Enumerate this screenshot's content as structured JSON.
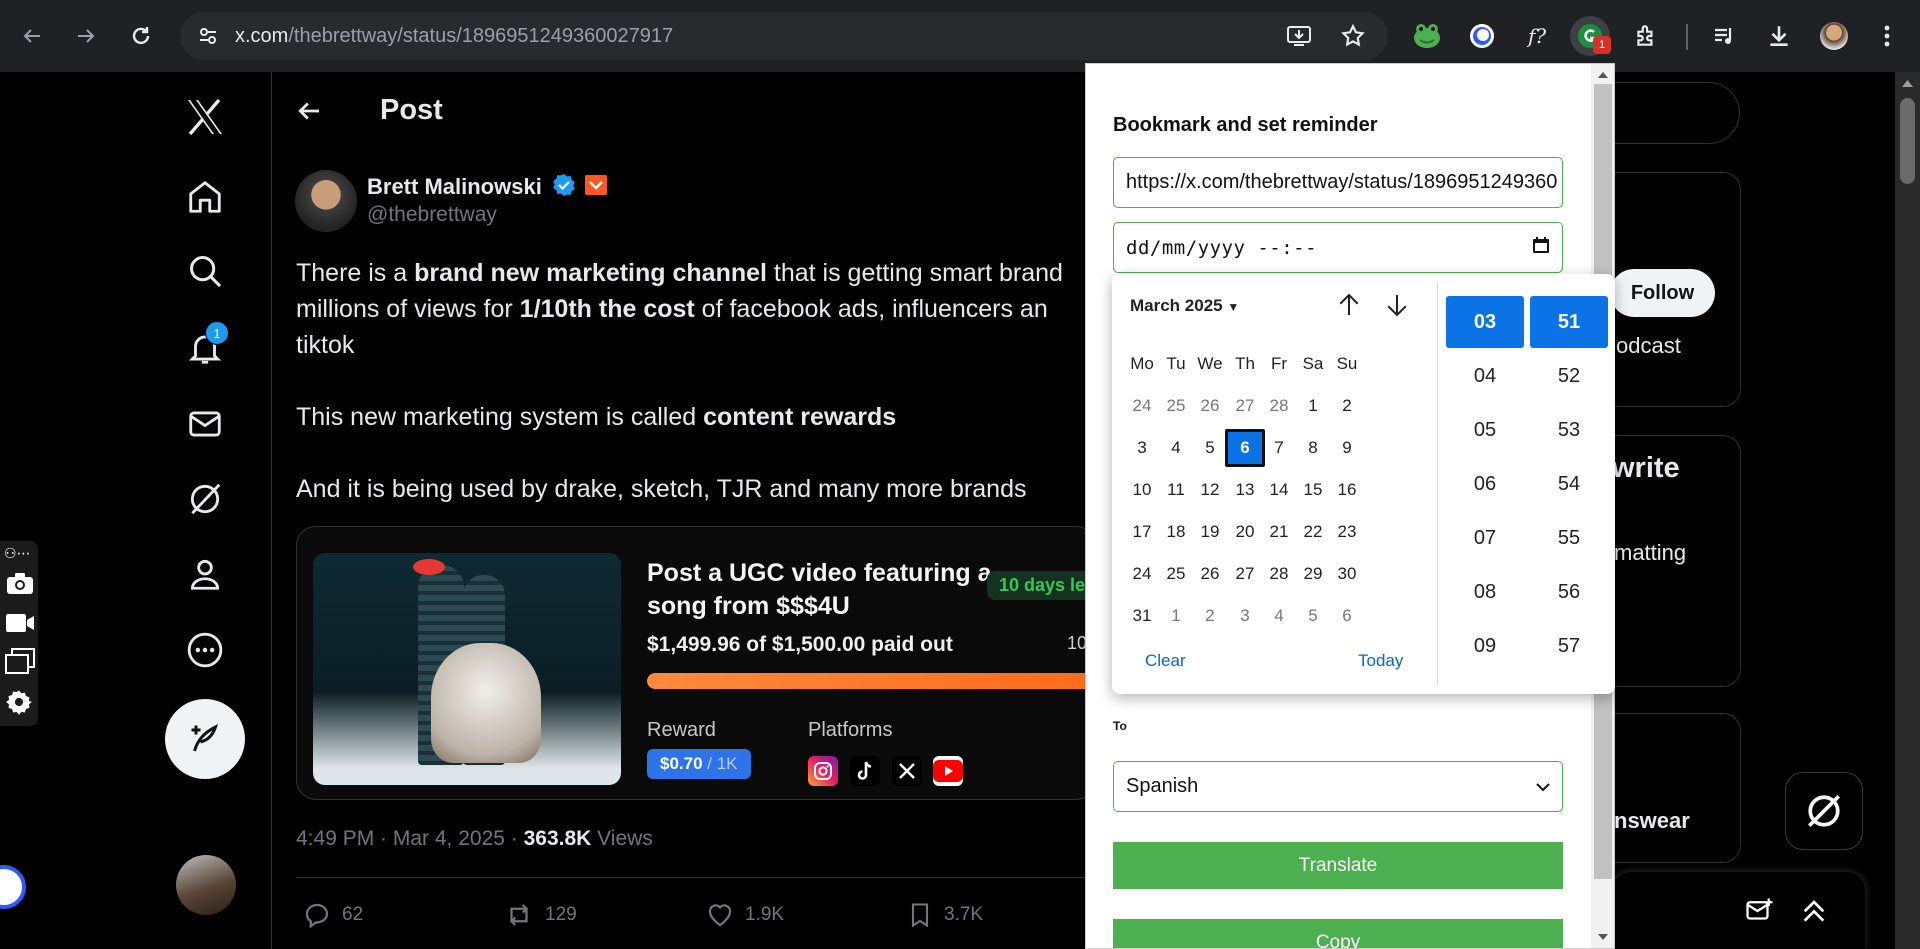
{
  "browser": {
    "url_host": "x.com",
    "url_path": "/thebrettway/status/1896951249360027917",
    "extension_badge": "1"
  },
  "nav": {
    "notifications_badge": "1"
  },
  "post": {
    "header_title": "Post",
    "author_name": "Brett Malinowski",
    "author_handle": "@thebrettway",
    "line1_a": "There is a ",
    "line1_b": "brand new marketing channel",
    "line1_c": " that is getting smart brand",
    "line2_a": "millions of views for ",
    "line2_b": "1/10th the cost",
    "line2_c": " of facebook ads, influencers an",
    "line3": "tiktok",
    "line4_a": "This new marketing system is called ",
    "line4_b": "content rewards",
    "line5": "And it is being used by drake, sketch, TJR and many more brands",
    "card": {
      "title": "Post a UGC video featuring a song from $$$4U",
      "days_pill": "10 days le",
      "paid_text": "$1,499.96 of $1,500.00 paid out",
      "paid_count": "10",
      "progress_percent": 99.9,
      "reward_label": "Reward",
      "reward_value": "$0.70",
      "reward_unit": "/ 1K",
      "platforms_label": "Platforms",
      "platforms": [
        "instagram-icon",
        "tiktok-icon",
        "x-icon",
        "youtube-icon"
      ]
    },
    "meta_time": "4:49 PM · Mar 4, 2025 · ",
    "meta_views_count": "363.8K",
    "meta_views_label": " Views",
    "stats": {
      "replies": "62",
      "reposts": "129",
      "likes": "1.9K",
      "bookmarks": "3.7K"
    }
  },
  "sidebar": {
    "follow_label": "Follow",
    "podcast_text": "odcast",
    "write_text": "write",
    "matting_text": "matting",
    "nswear_text": "nswear"
  },
  "popup": {
    "heading": "Bookmark and set reminder",
    "url_value": "https://x.com/thebrettway/status/1896951249360",
    "date_placeholder": "dd/mm/yyyy --:--",
    "to_label": "To",
    "language_selected": "Spanish",
    "translate_label": "Translate",
    "copy_label": "Copy"
  },
  "picker": {
    "month_label": "March 2025",
    "weekdays": [
      "Mo",
      "Tu",
      "We",
      "Th",
      "Fr",
      "Sa",
      "Su"
    ],
    "weeks": [
      [
        "24",
        "25",
        "26",
        "27",
        "28",
        "1",
        "2"
      ],
      [
        "3",
        "4",
        "5",
        "6",
        "7",
        "8",
        "9"
      ],
      [
        "10",
        "11",
        "12",
        "13",
        "14",
        "15",
        "16"
      ],
      [
        "17",
        "18",
        "19",
        "20",
        "21",
        "22",
        "23"
      ],
      [
        "24",
        "25",
        "26",
        "27",
        "28",
        "29",
        "30"
      ],
      [
        "31",
        "1",
        "2",
        "3",
        "4",
        "5",
        "6"
      ]
    ],
    "today": "6",
    "clear_label": "Clear",
    "today_label": "Today",
    "hours": [
      "03",
      "04",
      "05",
      "06",
      "07",
      "08",
      "09"
    ],
    "minutes": [
      "51",
      "52",
      "53",
      "54",
      "55",
      "56",
      "57"
    ],
    "selected_hour": "03",
    "selected_minute": "51"
  },
  "colors": {
    "x_blue": "#1d9bf0",
    "popup_green": "#4caf50",
    "picker_blue": "#0b73e6",
    "progress_orange": "#ff7a2a"
  }
}
